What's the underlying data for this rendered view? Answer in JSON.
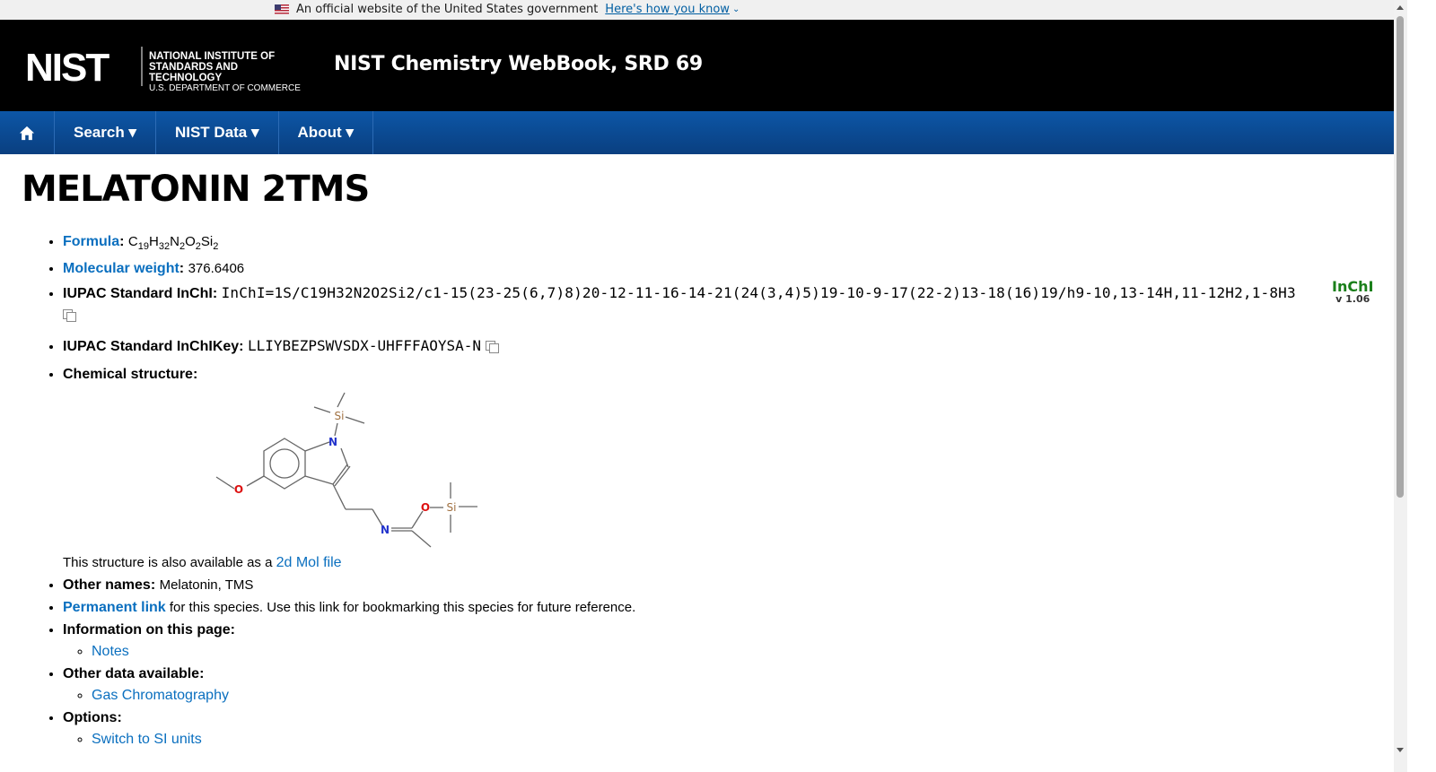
{
  "gov_banner": {
    "text": "An official website of the United States government",
    "how_link": "Here's how you know"
  },
  "header": {
    "logo_text": "NIST",
    "logo_lines": [
      "NATIONAL INSTITUTE OF",
      "STANDARDS AND TECHNOLOGY",
      "U.S. DEPARTMENT OF COMMERCE"
    ],
    "site_title": "NIST Chemistry WebBook, SRD 69"
  },
  "nav": {
    "home_icon": "home-icon",
    "items": [
      "Search ▾",
      "NIST Data ▾",
      "About ▾"
    ]
  },
  "page": {
    "title": "MELATONIN 2TMS",
    "formula_label": "Formula",
    "formula": {
      "C": "C",
      "c_n": "19",
      "H": "H",
      "h_n": "32",
      "N": "N",
      "n_n": "2",
      "O": "O",
      "o_n": "2",
      "Si": "Si",
      "si_n": "2"
    },
    "mw_label": "Molecular weight",
    "mw_value": "376.6406",
    "inchi_label": "IUPAC Standard InChI:",
    "inchi_value": "InChI=1S/C19H32N2O2Si2/c1-15(23-25(6,7)8)20-12-11-16-14-21(24(3,4)5)19-10-9-17(22-2)13-18(16)19/h9-10,13-14H,11-12H2,1-8H3",
    "inchikey_label": "IUPAC Standard InChIKey:",
    "inchikey_value": "LLIYBEZPSWVSDX-UHFFFAOYSA-N",
    "inchi_badge": "InChI",
    "inchi_version": "v 1.06",
    "structure_label": "Chemical structure:",
    "atoms": {
      "si": "Si",
      "n": "N",
      "o": "O"
    },
    "mol_prefix": "This structure is also available as a ",
    "mol_link": "2d Mol file",
    "other_names_label": "Other names:",
    "other_names": "Melatonin, TMS",
    "permalink": "Permanent link",
    "permalink_suffix": " for this species. Use this link for bookmarking this species for future reference.",
    "info_label": "Information on this page:",
    "info_items": [
      "Notes"
    ],
    "other_data_label": "Other data available:",
    "other_data_items": [
      "Gas Chromatography"
    ],
    "options_label": "Options:",
    "options_items": [
      "Switch to SI units"
    ]
  },
  "colors": {
    "nav": "#0c56a6",
    "link": "#0a6fbf",
    "header": "#000000",
    "nitrogen": "#2233cc",
    "oxygen": "#dd1111",
    "silicon": "#a07040"
  }
}
